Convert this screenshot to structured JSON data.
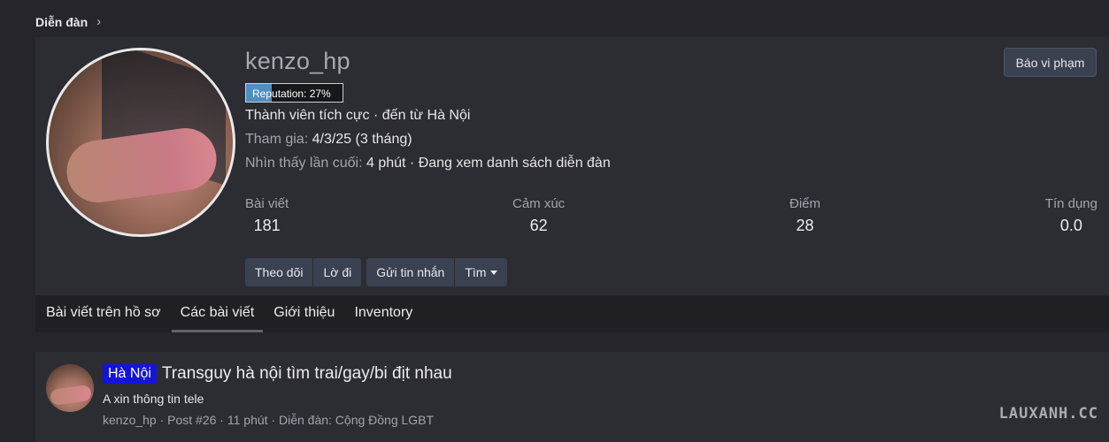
{
  "breadcrumb": {
    "label": "Diễn đàn",
    "separator": "›"
  },
  "profile": {
    "username": "kenzo_hp",
    "report_label": "Báo vi phạm",
    "reputation": {
      "label": "Reputation: 27%",
      "percent": 27
    },
    "line1": "Thành viên tích cực · đến từ Hà Nội",
    "joined_label": "Tham gia:",
    "joined_value": "4/3/25 (3 tháng)",
    "last_seen_label": "Nhìn thấy lần cuối:",
    "last_seen_value": "4 phút · Đang xem danh sách diễn đàn",
    "stats": {
      "posts": {
        "label": "Bài viết",
        "value": "181"
      },
      "reactions": {
        "label": "Cảm xúc",
        "value": "62"
      },
      "points": {
        "label": "Điểm",
        "value": "28"
      },
      "credit": {
        "label": "Tín dụng",
        "value": "0.0"
      }
    },
    "actions": {
      "follow": "Theo dõi",
      "ignore": "Lờ đi",
      "message": "Gửi tin nhắn",
      "find": "Tìm"
    }
  },
  "tabs": [
    "Bài viết trên hồ sơ",
    "Các bài viết",
    "Giới thiệu",
    "Inventory"
  ],
  "active_tab": "Các bài viết",
  "post": {
    "prefix": "Hà Nội",
    "title": "Transguy hà nội tìm trai/gay/bi địt nhau",
    "snippet": "A xin thông tin tele",
    "meta": "kenzo_hp · Post #26 · 11 phút · Diễn đàn: Cộng Đồng LGBT"
  },
  "watermark": "LAUXANH.CC",
  "colors": {
    "background": "#25252b",
    "card": "#2c2c33",
    "button": "#3a4150",
    "reputation_fill": "#4f8fc0",
    "prefix_badge": "#1414d8"
  }
}
